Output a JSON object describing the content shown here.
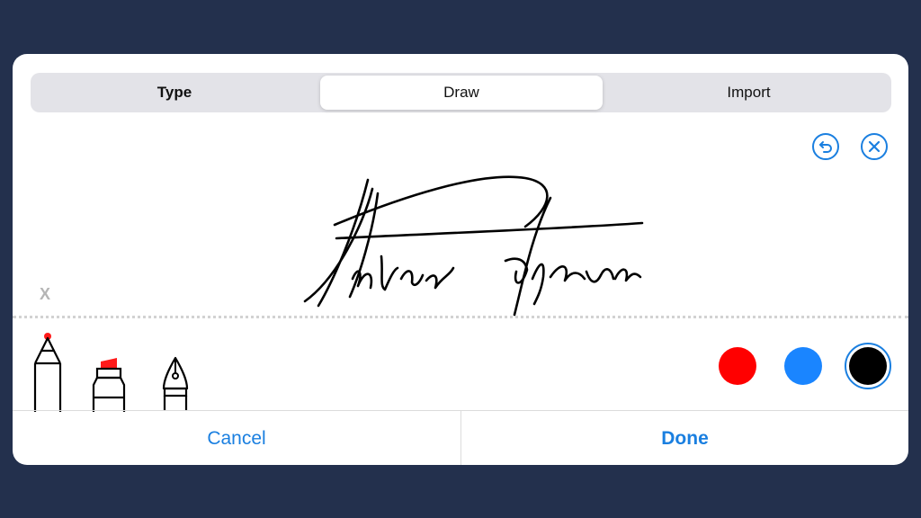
{
  "tabs": {
    "type_label": "Type",
    "draw_label": "Draw",
    "import_label": "Import",
    "selected": "Draw"
  },
  "canvas": {
    "sign_marker": "X",
    "undo_icon": "undo-icon",
    "clear_icon": "close-icon"
  },
  "tools": {
    "items": [
      "pencil-icon",
      "marker-icon",
      "fountain-pen-icon"
    ],
    "accent_color": "#ff1a1a"
  },
  "colors": {
    "red": "#ff0000",
    "blue": "#1a85ff",
    "black": "#000000",
    "selected": "black"
  },
  "footer": {
    "cancel_label": "Cancel",
    "done_label": "Done"
  }
}
